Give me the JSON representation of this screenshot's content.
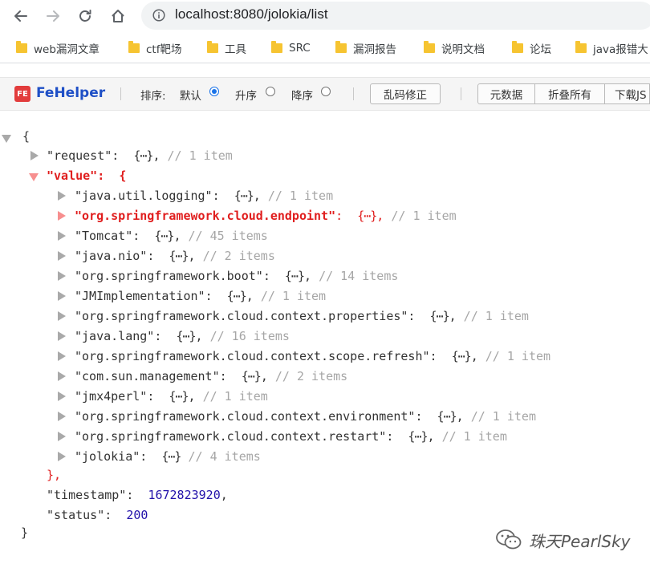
{
  "browser": {
    "url": "localhost:8080/jolokia/list"
  },
  "bookmarks": [
    {
      "label": "web漏洞文章"
    },
    {
      "label": "ctf靶场"
    },
    {
      "label": "工具"
    },
    {
      "label": "SRC"
    },
    {
      "label": "漏洞报告"
    },
    {
      "label": "说明文档"
    },
    {
      "label": "论坛"
    },
    {
      "label": "java报错大"
    }
  ],
  "fehelper": {
    "logo": "FE",
    "brand": "FeHelper",
    "sort_label": "排序:",
    "sort_default": "默认",
    "sort_asc": "升序",
    "sort_desc": "降序",
    "selected_sort": "默认",
    "fix_button": "乱码修正",
    "raw_button": "元数据",
    "collapse_button": "折叠所有",
    "download_button": "下载JS"
  },
  "json_view": {
    "open_brace": "{",
    "close_brace": "}",
    "request": {
      "key": "\"request\"",
      "collapsed": "{⋯}",
      "comment": "// 1 item"
    },
    "value": {
      "key": "\"value\"",
      "open": "{",
      "close": "},"
    },
    "items": [
      {
        "key": "\"java.util.logging\"",
        "comment": "// 1 item",
        "highlight": false
      },
      {
        "key": "\"org.springframework.cloud.endpoint\"",
        "comment": "// 1 item",
        "highlight": true
      },
      {
        "key": "\"Tomcat\"",
        "comment": "// 45 items",
        "highlight": false
      },
      {
        "key": "\"java.nio\"",
        "comment": "// 2 items",
        "highlight": false
      },
      {
        "key": "\"org.springframework.boot\"",
        "comment": "// 14 items",
        "highlight": false
      },
      {
        "key": "\"JMImplementation\"",
        "comment": "// 1 item",
        "highlight": false
      },
      {
        "key": "\"org.springframework.cloud.context.properties\"",
        "comment": "// 1 item",
        "highlight": false
      },
      {
        "key": "\"java.lang\"",
        "comment": "// 16 items",
        "highlight": false
      },
      {
        "key": "\"org.springframework.cloud.context.scope.refresh\"",
        "comment": "// 1 item",
        "highlight": false
      },
      {
        "key": "\"com.sun.management\"",
        "comment": "// 2 items",
        "highlight": false
      },
      {
        "key": "\"jmx4perl\"",
        "comment": "// 1 item",
        "highlight": false
      },
      {
        "key": "\"org.springframework.cloud.context.environment\"",
        "comment": "// 1 item",
        "highlight": false
      },
      {
        "key": "\"org.springframework.cloud.context.restart\"",
        "comment": "// 1 item",
        "highlight": false
      },
      {
        "key": "\"jolokia\"",
        "comment": "// 4 items",
        "highlight": false,
        "last": true
      }
    ],
    "timestamp": {
      "key": "\"timestamp\"",
      "value": "1672823920"
    },
    "status": {
      "key": "\"status\"",
      "value": "200"
    }
  },
  "watermark": {
    "text": "珠天PearlSky"
  }
}
